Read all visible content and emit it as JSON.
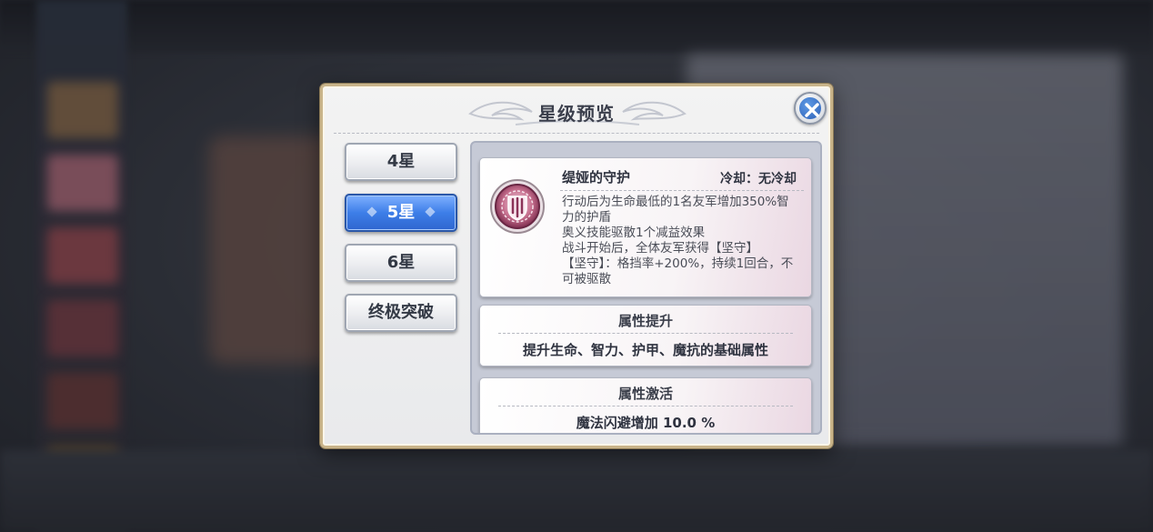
{
  "dialog": {
    "title": "星级预览",
    "close_icon": "close-x-icon"
  },
  "tabs": [
    {
      "label": "4星",
      "active": false
    },
    {
      "label": "5星",
      "active": true
    },
    {
      "label": "6星",
      "active": false
    },
    {
      "label": "终极突破",
      "active": false
    }
  ],
  "skill": {
    "icon": "shield-emblem-icon",
    "name": "缇娅的守护",
    "cooldown": "冷却：无冷却",
    "desc_lines": [
      "行动后为生命最低的1名友军增加350%智",
      "力的护盾",
      "奥义技能驱散1个减益效果",
      "战斗开始后，全体友军获得【坚守】",
      "【坚守】：格挡率+200%，持续1回合，不",
      "可被驱散"
    ]
  },
  "attribute_boost": {
    "title": "属性提升",
    "text": "提升生命、智力、护甲、魔抗的基础属性"
  },
  "attribute_activate": {
    "title": "属性激活",
    "text": "魔法闪避增加  10.0  %"
  },
  "colors": {
    "active_tab": "#3d7ee8",
    "frame_gold": "#c9b48a",
    "icon_ring": "#a3476e"
  }
}
